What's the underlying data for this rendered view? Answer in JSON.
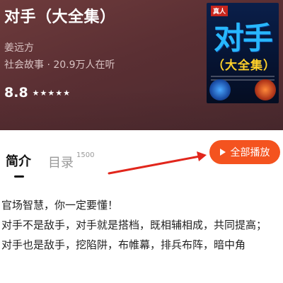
{
  "book": {
    "title": "对手（大全集）",
    "author": "姜远方",
    "meta": "社会故事 · 20.9万人在听",
    "rating": "8.8",
    "stars": "★★★★★"
  },
  "cover": {
    "badge": "真人",
    "big_title": "对手",
    "subtitle": "（大全集）"
  },
  "tabs": {
    "intro": "简介",
    "toc": "目录",
    "toc_count": "1500"
  },
  "actions": {
    "play_all": "全部播放"
  },
  "description": {
    "line1": "官场智慧，你一定要懂！",
    "line2": "对手不是敌手，对手就是搭档，既相辅相成，共同提高；",
    "line3": "对手也是敌手，挖陷阱，布帷幕，排兵布阵，暗中角"
  },
  "colors": {
    "header_bg": "#5a2f33",
    "accent": "#f4531f",
    "arrow_red": "#e1261c"
  }
}
